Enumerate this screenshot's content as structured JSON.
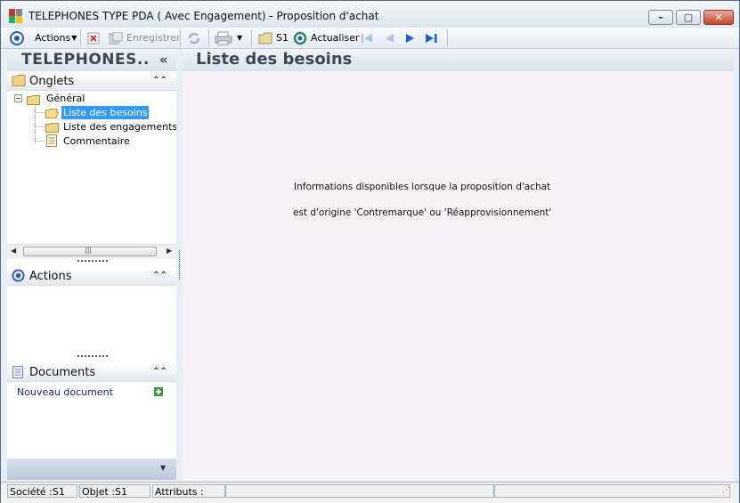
{
  "window": {
    "title": "TELEPHONES TYPE PDA ( Avec Engagement) -  Proposition d'achat",
    "minimize": "–",
    "maximize": "▢",
    "close": "✕"
  },
  "toolbar": {
    "actions": "Actions",
    "enregistrer": "Enregistrer",
    "s1": "S1",
    "actualiser": "Actualiser"
  },
  "left": {
    "header": "TELEPHONES..",
    "collapse": "«",
    "onglets": {
      "title": "Onglets",
      "root": "Général",
      "items": [
        "Liste des besoins",
        "Liste des engagements",
        "Commentaire"
      ],
      "selected": 0
    },
    "actions": {
      "title": "Actions"
    },
    "documents": {
      "title": "Documents",
      "new": "Nouveau document"
    }
  },
  "main": {
    "title": "Liste des besoins",
    "line1": "Informations disponibles lorsque la proposition d'achat",
    "line2": "est d'origine 'Contremarque' ou 'Réapprovisionnement'"
  },
  "status": {
    "societe": "Société :S1",
    "objet": "Objet :S1",
    "attributs": "Attributs :"
  },
  "colors": {
    "selection": "#3399ff",
    "header_text": "#3b4756",
    "link": "#1a237e"
  }
}
